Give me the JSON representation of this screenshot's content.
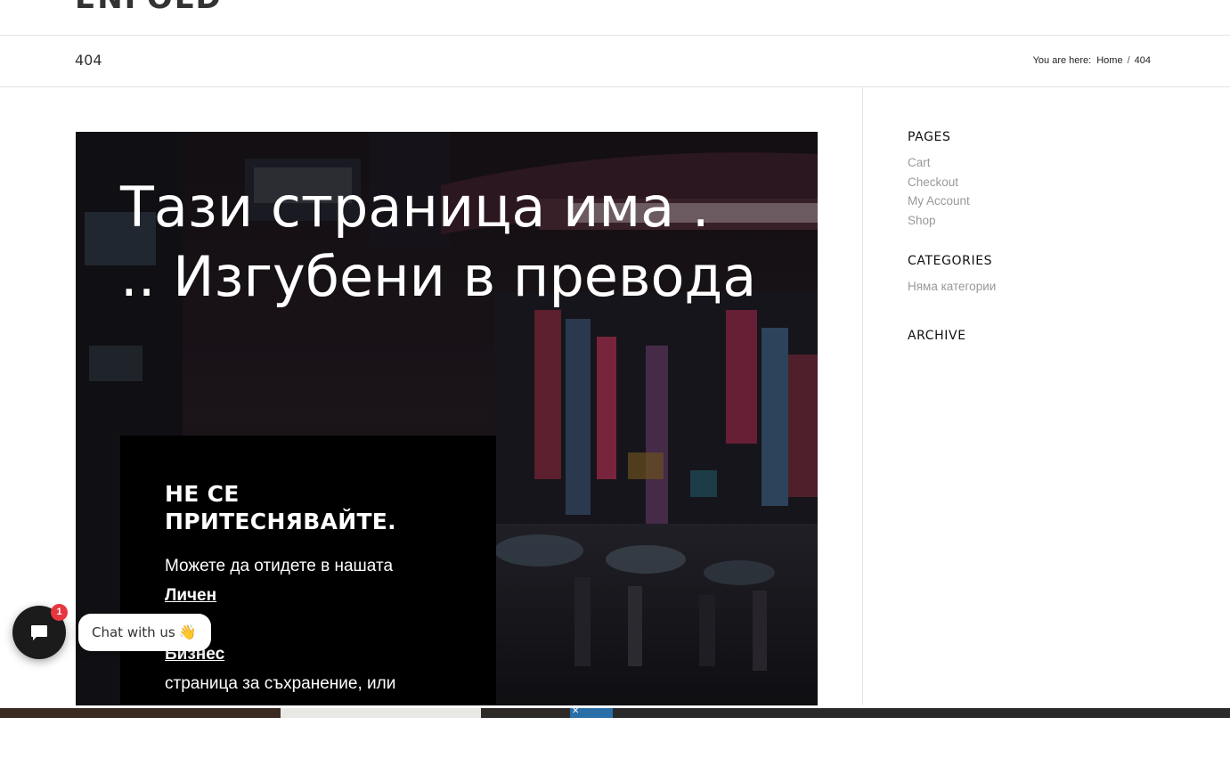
{
  "header": {
    "logo": "ENFOLD"
  },
  "title_bar": {
    "title": "404",
    "breadcrumb": {
      "prefix": "You are here:",
      "home": "Home",
      "separator": "/",
      "current": "404"
    }
  },
  "hero": {
    "title": "Тази страница има . .. Изгубени в превода",
    "box": {
      "heading": "НЕ СЕ ПРИТЕСНЯВАЙТЕ.",
      "line1": "Можете да отидете в нашата",
      "link1": "Личен",
      "link2": "Бизнес",
      "line2": "страница за съхранение, или"
    }
  },
  "sidebar": {
    "pages": {
      "title": "PAGES",
      "items": [
        "Cart",
        "Checkout",
        "My Account",
        "Shop"
      ]
    },
    "categories": {
      "title": "CATEGORIES",
      "items": [
        "Няма категории"
      ]
    },
    "archive": {
      "title": "ARCHIVE"
    }
  },
  "chat": {
    "badge": "1",
    "label": "Chat with us",
    "emoji": "👋"
  },
  "colors": {
    "badge": "#e8363f",
    "launcher": "#1b1b1b",
    "hero_box": "#000000"
  }
}
